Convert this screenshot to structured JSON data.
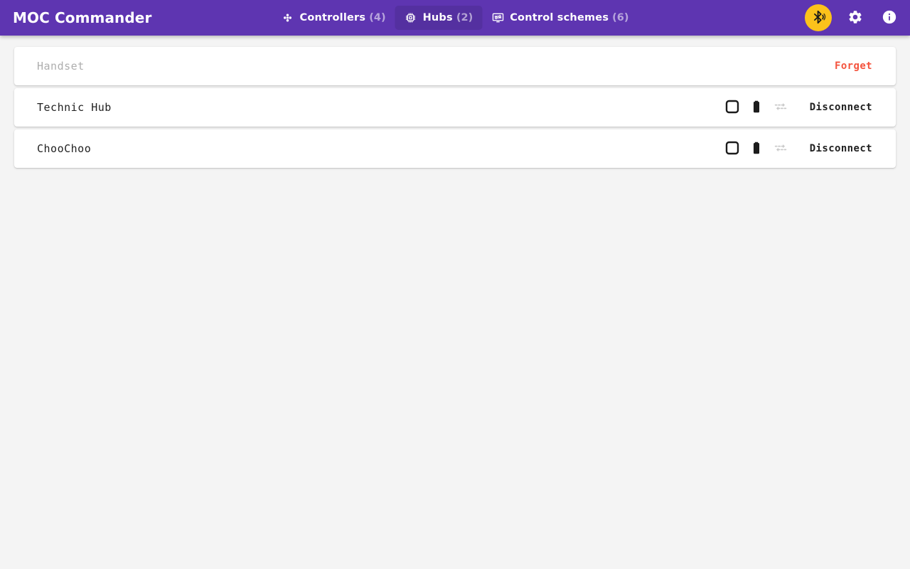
{
  "app": {
    "title": "MOC Commander",
    "header_color": "#5e35b1",
    "accent_color": "#fcc21b",
    "danger_color": "#f4533d",
    "page_background": "#f4f4f4"
  },
  "tabs": [
    {
      "id": "controllers",
      "icon": "gamepad-icon",
      "label": "Controllers",
      "count": "(4)",
      "active": false
    },
    {
      "id": "hubs",
      "icon": "chip-icon",
      "label": "Hubs",
      "count": "(2)",
      "active": true
    },
    {
      "id": "control-schemes",
      "icon": "control-scheme-icon",
      "label": "Control schemes",
      "count": "(6)",
      "active": false
    }
  ],
  "header_actions": [
    {
      "id": "bluetooth",
      "icon": "bluetooth-searching-icon",
      "label": "Bluetooth scan"
    },
    {
      "id": "settings",
      "icon": "gear-icon",
      "label": "Settings"
    },
    {
      "id": "about",
      "icon": "info-icon",
      "label": "About"
    }
  ],
  "devices": [
    {
      "name": "Handset",
      "connected": false,
      "action_label": "Forget",
      "action_kind": "danger",
      "icons": []
    },
    {
      "name": "Technic Hub",
      "connected": true,
      "action_label": "Disconnect",
      "action_kind": "neutral",
      "icons": [
        {
          "id": "led-color",
          "icon": "rounded-square-icon",
          "state": "active"
        },
        {
          "id": "battery",
          "icon": "battery-full-icon",
          "state": "active"
        },
        {
          "id": "data-transfer",
          "icon": "data-transfer-icon",
          "state": "disabled"
        }
      ]
    },
    {
      "name": "ChooChoo",
      "connected": true,
      "action_label": "Disconnect",
      "action_kind": "neutral",
      "icons": [
        {
          "id": "led-color",
          "icon": "rounded-square-icon",
          "state": "active"
        },
        {
          "id": "battery",
          "icon": "battery-full-icon",
          "state": "active"
        },
        {
          "id": "data-transfer",
          "icon": "data-transfer-icon",
          "state": "disabled"
        }
      ]
    }
  ]
}
